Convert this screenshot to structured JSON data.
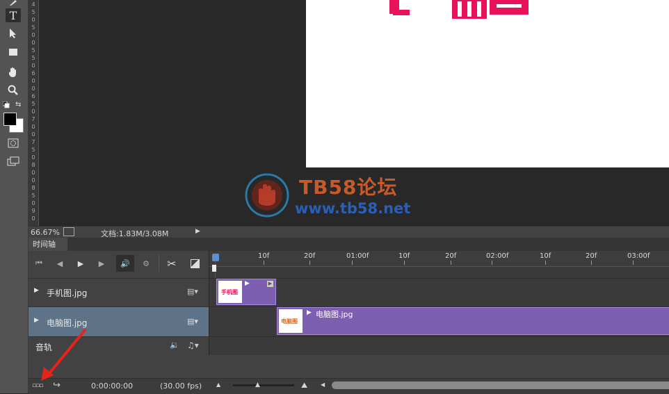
{
  "tools": [
    {
      "name": "type-tool",
      "glyph": "T"
    },
    {
      "name": "path-select-tool",
      "glyph": "➤"
    },
    {
      "name": "rectangle-tool",
      "glyph": "▭"
    },
    {
      "name": "hand-tool",
      "glyph": "✋"
    },
    {
      "name": "zoom-tool",
      "glyph": "🔍"
    }
  ],
  "ruler_vertical": [
    "4",
    "5",
    "0",
    "5",
    "0",
    "0",
    "5",
    "5",
    "0",
    "6",
    "0",
    "0",
    "6",
    "5",
    "0",
    "7",
    "0",
    "0",
    "7",
    "5",
    "0",
    "8",
    "0",
    "0",
    "8",
    "5",
    "0",
    "9",
    "0"
  ],
  "canvas": {
    "text_partial": "手机图"
  },
  "watermark": {
    "title": "TB58论坛",
    "url": "www.tb58.net"
  },
  "status": {
    "zoom": "66.67%",
    "doc_info": "文档:1.83M/3.08M"
  },
  "timeline": {
    "tab_label": "时间轴",
    "ruler_labels": [
      "10f",
      "20f",
      "01:00f",
      "10f",
      "20f",
      "02:00f",
      "10f",
      "20f",
      "03:00f"
    ],
    "tracks": [
      {
        "name": "手机图.jpg"
      },
      {
        "name": "电脑图.jpg"
      },
      {
        "name": "音轨"
      }
    ],
    "clips": [
      {
        "label": "",
        "thumb_text": "手机图"
      },
      {
        "label": "电脑图.jpg",
        "thumb_text": "电脑图"
      }
    ],
    "timecode": "0:00:00:00",
    "fps": "(30.00 fps)"
  },
  "colors": {
    "accent": "#e8115a",
    "clip": "#7d5fb2",
    "selected_track": "#5f7388",
    "playhead": "#cc2222"
  }
}
